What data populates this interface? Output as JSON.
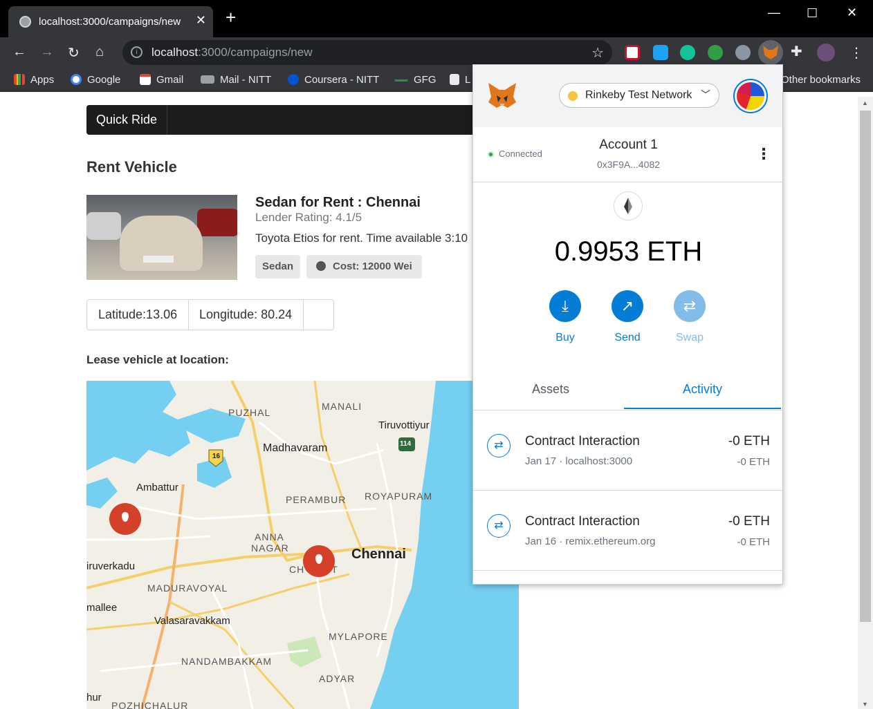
{
  "browser": {
    "tab_title": "localhost:3000/campaigns/new",
    "url_host": "localhost",
    "url_rest": ":3000/campaigns/new",
    "bookmarks": [
      "Apps",
      "Google",
      "Gmail",
      "Mail - NITT",
      "Coursera - NITT",
      "GFG",
      "L"
    ],
    "other_bookmarks": "Other bookmarks"
  },
  "page": {
    "brand": "Quick Ride",
    "heading": "Rent Vehicle",
    "card": {
      "title": "Sedan for Rent : Chennai",
      "meta": "Lender Rating: 4.1/5",
      "description": "Toyota Etios for rent. Time available 3:10",
      "label_type": "Sedan",
      "label_cost": "Cost: 12000 Wei"
    },
    "latitude": "Latitude:13.06",
    "longitude": "Longitude: 80.24",
    "lease_label": "Lease vehicle at location:",
    "map_labels": {
      "puzhal": "PUZHAL",
      "manali": "MANALI",
      "tiruvottiyur": "Tiruvottiyur",
      "madhavaram": "Madhavaram",
      "ambattur": "Ambattur",
      "perambur": "PERAMBUR",
      "royapuram": "ROYAPURAM",
      "anna": "ANNA",
      "nagar": "NAGAR",
      "chennai": "Chennai",
      "chetpet": "CH        T",
      "iruverkadu": "iruverkadu",
      "maduravoyal": "MADURAVOYAL",
      "mallee": "mallee",
      "valasaravakkam": "Valasaravakkam",
      "mylapore": "MYLAPORE",
      "nandambakkam": "NANDAMBAKKAM",
      "adyar": "ADYAR",
      "pozhichalur": "POZHICHALUR",
      "hur": "hur",
      "shield_16": "16",
      "shield_114": "114"
    }
  },
  "metamask": {
    "network": "Rinkeby Test Network",
    "connected": "Connected",
    "account_name": "Account 1",
    "account_address": "0x3F9A...4082",
    "balance": "0.9953 ETH",
    "actions": {
      "buy": "Buy",
      "send": "Send",
      "swap": "Swap"
    },
    "tabs": {
      "assets": "Assets",
      "activity": "Activity"
    },
    "transactions": [
      {
        "title": "Contract Interaction",
        "subtitle": "Jan 17 · localhost:3000",
        "amount": "-0 ETH",
        "fiat": "-0 ETH"
      },
      {
        "title": "Contract Interaction",
        "subtitle": "Jan 16 · remix.ethereum.org",
        "amount": "-0 ETH",
        "fiat": "-0 ETH"
      }
    ]
  },
  "colors": {
    "metamask_blue": "#037dd6",
    "pin_red": "#d5402b",
    "map_water": "#75cff0",
    "navbar_dark": "#1b1c1d"
  }
}
